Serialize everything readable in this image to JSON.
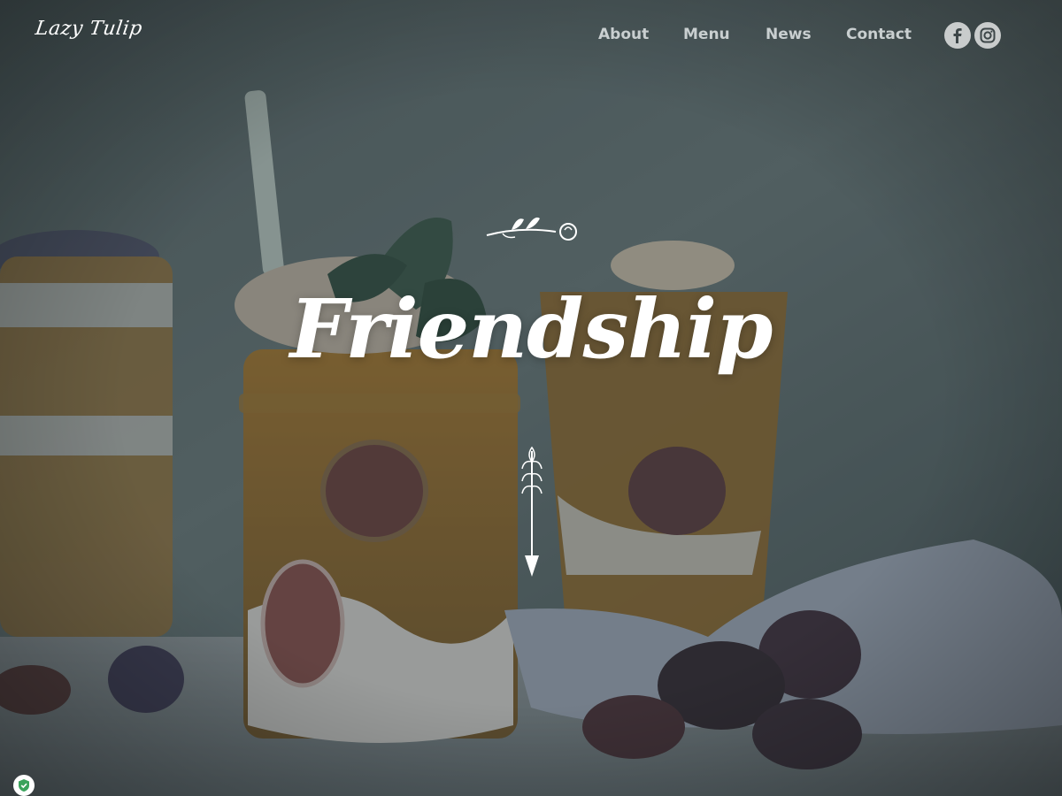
{
  "brand": {
    "logo_text": "Lazy Tulip"
  },
  "nav": {
    "items": [
      {
        "label": "About"
      },
      {
        "label": "Menu"
      },
      {
        "label": "News"
      },
      {
        "label": "Contact"
      }
    ],
    "social": [
      {
        "icon": "facebook-icon"
      },
      {
        "icon": "instagram-icon"
      }
    ]
  },
  "hero": {
    "title": "Friendship",
    "scroll_icon": "arrow-down-icon",
    "ornament_icon": "floral-sprig-icon"
  },
  "colors": {
    "overlay": "#2b3436",
    "nav_text": "#c9cfd0",
    "title": "#ffffff",
    "badge_shield": "#3aa35b"
  },
  "badge": {
    "icon": "shield-check-icon"
  }
}
